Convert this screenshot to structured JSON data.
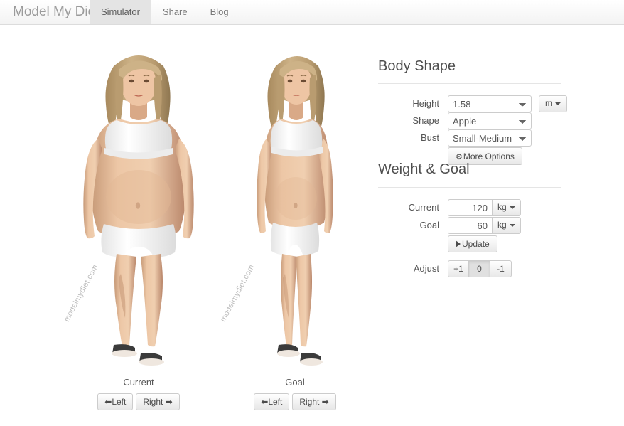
{
  "navbar": {
    "brand": "Model My Diet",
    "tabs": [
      {
        "label": "Simulator",
        "active": true
      },
      {
        "label": "Share",
        "active": false
      },
      {
        "label": "Blog",
        "active": false
      }
    ]
  },
  "figures": {
    "watermark": "modelmydiet.com",
    "current": {
      "caption": "Current",
      "left_label": "Left",
      "right_label": "Right"
    },
    "goal": {
      "caption": "Goal",
      "left_label": "Left",
      "right_label": "Right"
    }
  },
  "body_shape": {
    "title": "Body Shape",
    "height": {
      "label": "Height",
      "value": "1.58",
      "unit": "m"
    },
    "shape": {
      "label": "Shape",
      "value": "Apple"
    },
    "bust": {
      "label": "Bust",
      "value": "Small-Medium"
    },
    "more_options_label": "More Options",
    "gear_icon": "⚙"
  },
  "weight_goal": {
    "title": "Weight & Goal",
    "current": {
      "label": "Current",
      "value": "120",
      "unit": "kg"
    },
    "goal": {
      "label": "Goal",
      "value": "60",
      "unit": "kg"
    },
    "update_label": "Update",
    "adjust": {
      "label": "Adjust",
      "options": [
        "+1",
        "0",
        "-1"
      ],
      "selected": "0"
    }
  },
  "colors": {
    "navbar_bg": "#f3f3f3",
    "active_tab_bg": "#e4e4e4",
    "text": "#555555",
    "border": "#cccccc",
    "skin": "#e8c4a6",
    "hair": "#c2a578",
    "garment": "#fdfdfd"
  }
}
